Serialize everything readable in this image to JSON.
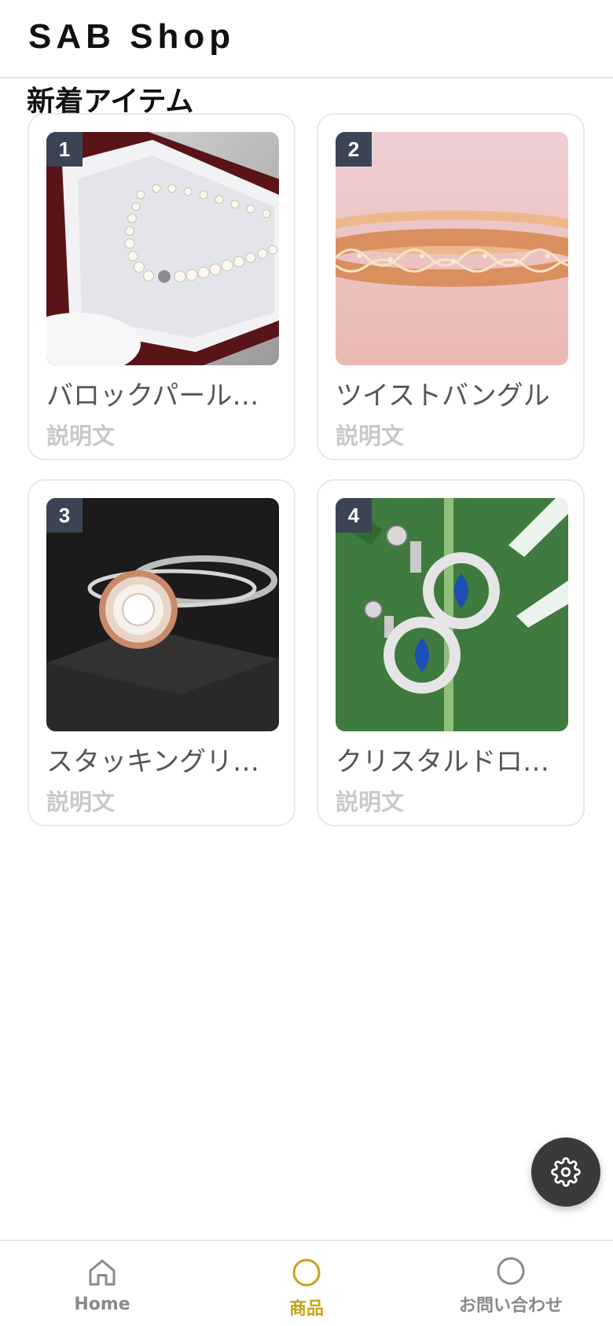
{
  "header": {
    "app_title": "SAB Shop"
  },
  "main": {
    "section_title": "新着アイテム",
    "products": [
      {
        "rank": "1",
        "name": "バロックパールネ...",
        "description": "説明文",
        "image_icon": "pearl-necklace-image"
      },
      {
        "rank": "2",
        "name": "ツイストバングル",
        "description": "説明文",
        "image_icon": "bangle-image"
      },
      {
        "rank": "3",
        "name": "スタッキングリン...",
        "description": "説明文",
        "image_icon": "ring-image"
      },
      {
        "rank": "4",
        "name": "クリスタルドロッ...",
        "description": "説明文",
        "image_icon": "earrings-image"
      }
    ]
  },
  "fab": {
    "icon": "gear-icon"
  },
  "tabbar": {
    "tabs": [
      {
        "label": "Home",
        "icon": "home-icon",
        "active": false
      },
      {
        "label": "商品",
        "icon": "circle-icon",
        "active": true
      },
      {
        "label": "お問い合わせ",
        "icon": "circle-icon",
        "active": false
      }
    ],
    "active_color": "#c9a21a",
    "inactive_color": "#8a8a8a"
  },
  "colors": {
    "badge_bg": "#3b4454",
    "fab_bg": "#3a3a3a"
  }
}
